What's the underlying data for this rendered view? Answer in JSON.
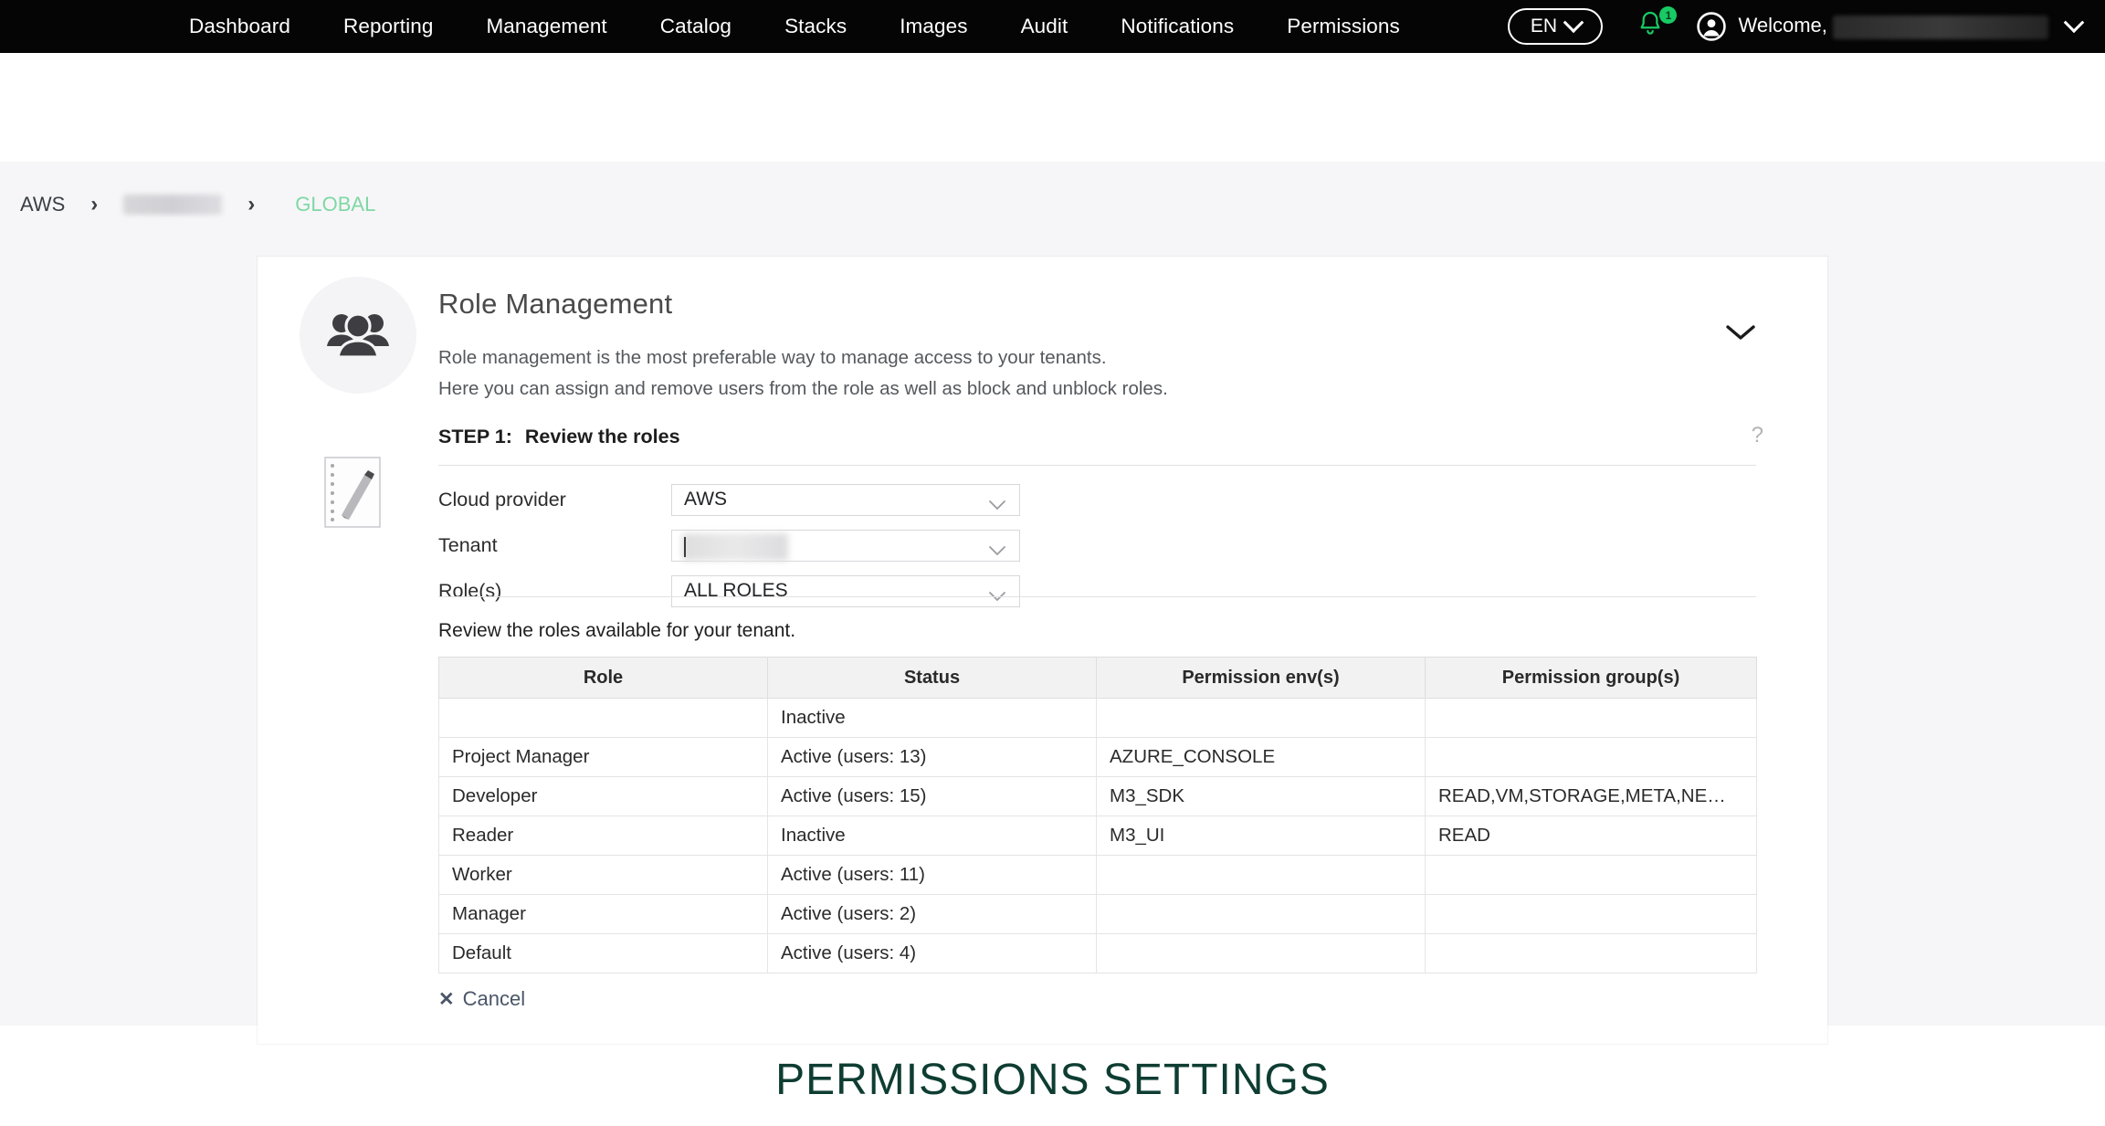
{
  "nav": {
    "items": [
      {
        "label": "Dashboard"
      },
      {
        "label": "Reporting"
      },
      {
        "label": "Management"
      },
      {
        "label": "Catalog"
      },
      {
        "label": "Stacks"
      },
      {
        "label": "Images"
      },
      {
        "label": "Audit"
      },
      {
        "label": "Notifications"
      },
      {
        "label": "Permissions"
      }
    ],
    "language": "EN",
    "notification_badge": "1",
    "welcome_label": "Welcome,",
    "icons": {
      "bell": "bell-icon",
      "avatar": "user-avatar-icon",
      "lang_chevron": "chevron-down-icon",
      "user_chevron": "chevron-down-icon"
    }
  },
  "breadcrumb": {
    "root": "AWS",
    "separator": "›",
    "current": "GLOBAL"
  },
  "card": {
    "title": "Role Management",
    "description_line1": "Role management is the most preferable way to manage access to your tenants.",
    "description_line2": "Here you can assign and remove users from the role as well as block and unblock roles.",
    "collapse_icon": "chevron-down-icon",
    "group_icon": "people-group-icon",
    "note_icon": "notepad-pencil-icon"
  },
  "step": {
    "number": "STEP 1:",
    "title": "Review the roles",
    "help": "?"
  },
  "form": {
    "fields": [
      {
        "label": "Cloud provider",
        "value": "AWS",
        "redacted": false
      },
      {
        "label": "Tenant",
        "value": "",
        "redacted": true
      },
      {
        "label": "Role(s)",
        "value": "ALL ROLES",
        "redacted": false
      }
    ]
  },
  "table": {
    "caption": "Review the roles available for your tenant.",
    "columns": [
      "Role",
      "Status",
      "Permission env(s)",
      "Permission group(s)"
    ],
    "rows": [
      [
        "",
        "Inactive",
        "",
        ""
      ],
      [
        "Project Manager",
        "Active (users: 13)",
        "AZURE_CONSOLE",
        ""
      ],
      [
        "Developer",
        "Active (users: 15)",
        "M3_SDK",
        "READ,VM,STORAGE,META,NEW_R..."
      ],
      [
        "Reader",
        "Inactive",
        "M3_UI",
        "READ"
      ],
      [
        "Worker",
        "Active (users: 11)",
        "",
        ""
      ],
      [
        "Manager",
        "Active (users: 2)",
        "",
        ""
      ],
      [
        "Default",
        "Active (users: 4)",
        "",
        ""
      ]
    ]
  },
  "actions": {
    "cancel_x": "✕",
    "cancel_label": "Cancel"
  },
  "footer": {
    "banner": "PERMISSIONS SETTINGS"
  },
  "colors": {
    "nav_bg": "#050505",
    "accent_green": "#18c964",
    "breadcrumb_current": "#7fd8a4",
    "page_bg": "#f6f6f8",
    "footer_text": "#0e3d32"
  }
}
